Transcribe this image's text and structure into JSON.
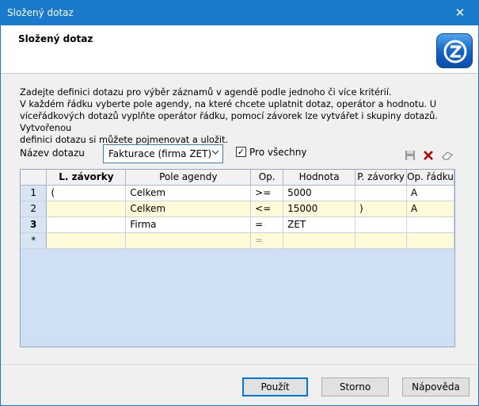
{
  "window": {
    "title": "Složený dotaz",
    "close": "✕"
  },
  "header": {
    "title": "Složený dotaz"
  },
  "description": [
    "Zadejte definici dotazu pro výběr záznamů v agendě podle jednoho či více kritérií.",
    "V každém řádku vyberte pole agendy, na které chcete uplatnit dotaz, operátor a hodnotu. U",
    "víceřádkových dotazů vyplňte operátor řádku, pomocí závorek lze vytvářet i skupiny dotazů. Vytvořenou",
    "definici dotazu si můžete pojmenovat a uložit."
  ],
  "query_name": {
    "label": "Název dotazu",
    "value": "Fakturace (firma ZET)"
  },
  "for_all": {
    "label": "Pro všechny",
    "checked": true
  },
  "toolbar": {
    "save_icon": "save-icon",
    "delete_icon": "delete-icon",
    "clear_icon": "eraser-icon"
  },
  "grid": {
    "columns": [
      "",
      "L. závorky",
      "Pole agendy",
      "Op.",
      "Hodnota",
      "P. závorky",
      "Op. řádku"
    ],
    "rows": [
      {
        "num": "1",
        "lz": "(",
        "field": "Celkem",
        "op": ">=",
        "value": "5000",
        "pz": "",
        "rowop": "A"
      },
      {
        "num": "2",
        "lz": "",
        "field": "Celkem",
        "op": "<=",
        "value": "15000",
        "pz": ")",
        "rowop": "A"
      },
      {
        "num": "3",
        "lz": "",
        "field": "Firma",
        "op": "=",
        "value": "ZET",
        "pz": "",
        "rowop": ""
      },
      {
        "num": "*",
        "lz": "",
        "field": "",
        "op": "=",
        "value": "",
        "pz": "",
        "rowop": ""
      }
    ]
  },
  "buttons": {
    "apply": "Použít",
    "cancel": "Storno",
    "help": "Nápověda"
  }
}
